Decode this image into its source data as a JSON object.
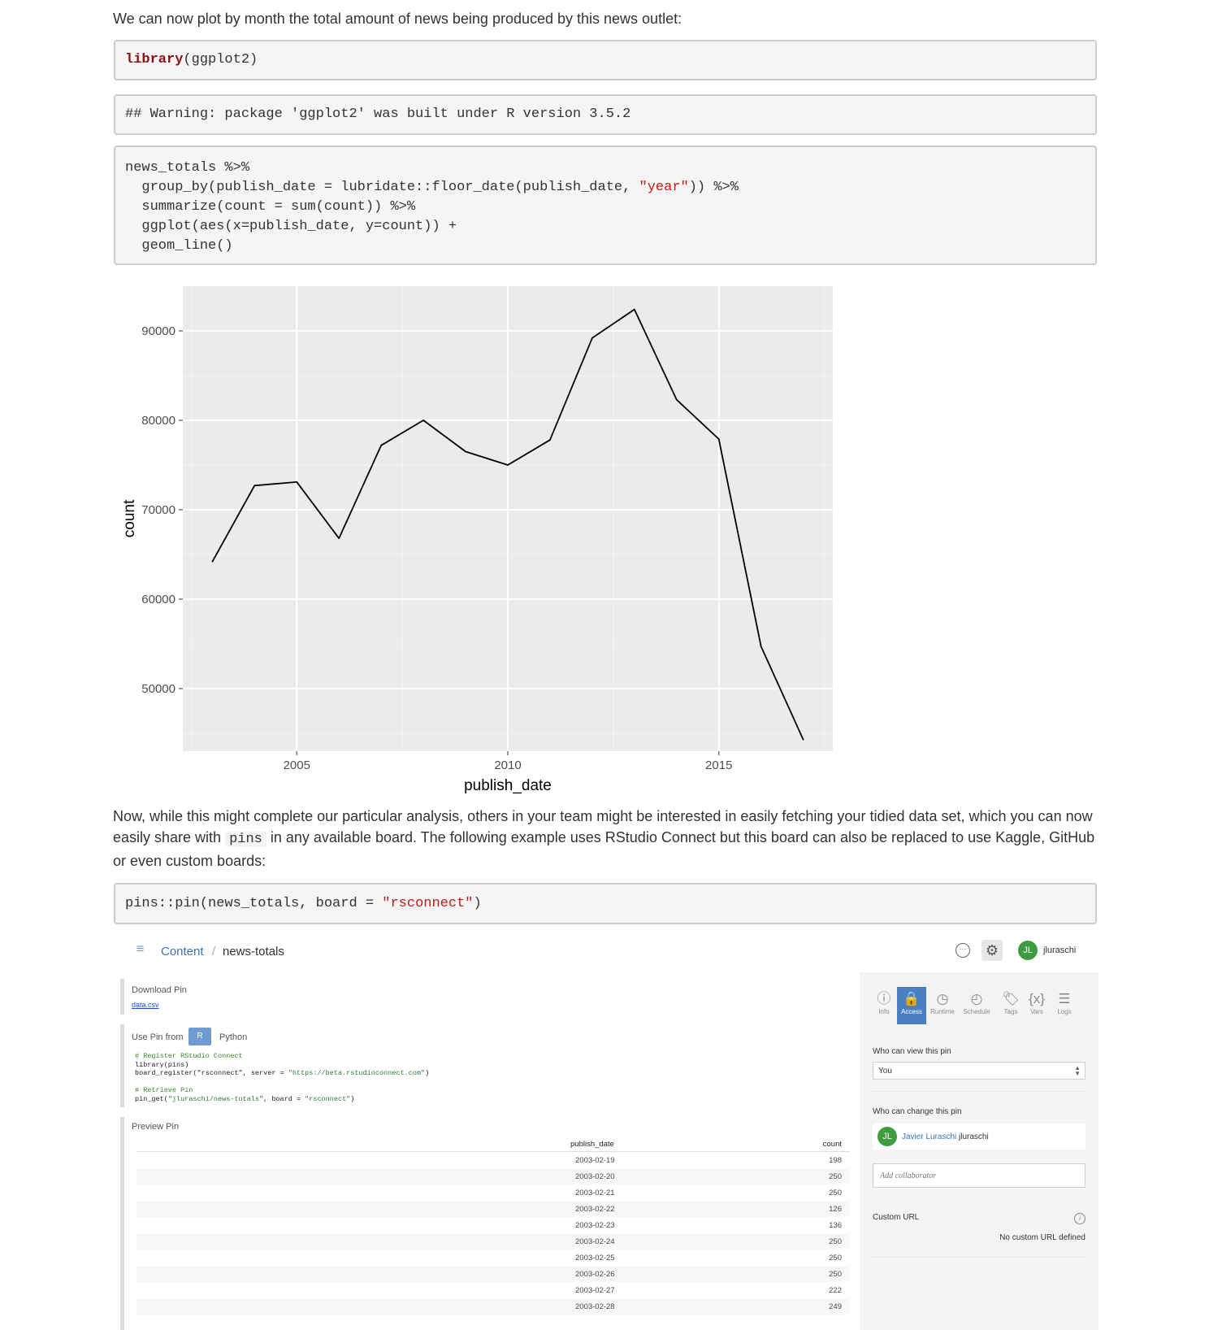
{
  "prose": {
    "p1": "We can now plot by month the total amount of news being produced by this news outlet:",
    "p2a": "Now, while this might complete our particular analysis, others in your team might be interested in easily fetching your tidied data set, which you can now easily share with ",
    "p2code": "pins",
    "p2b": " in any available board. The following example uses RStudio Connect but this board can also be replaced to use Kaggle, GitHub or even custom boards:"
  },
  "code": {
    "block1_kw": "library",
    "block1_rest": "(ggplot2)",
    "output1": "## Warning: package 'ggplot2' was built under R version 3.5.2",
    "block2_l1": "news_totals %>%",
    "block2_l2a": "  group_by(publish_date = lubridate::floor_date(publish_date, ",
    "block2_l2s": "\"year\"",
    "block2_l2b": ")) %>%",
    "block2_l3": "  summarize(count = sum(count)) %>%",
    "block2_l4": "  ggplot(aes(x=publish_date, y=count)) +",
    "block2_l5": "  geom_line()",
    "block3a": "pins::pin(news_totals, board = ",
    "block3s": "\"rsconnect\"",
    "block3b": ")"
  },
  "chart_data": {
    "type": "line",
    "xlabel": "publish_date",
    "ylabel": "count",
    "x": [
      2003,
      2004,
      2005,
      2006,
      2007,
      2008,
      2009,
      2010,
      2011,
      2012,
      2013,
      2014,
      2015,
      2016,
      2017
    ],
    "values": [
      64200,
      72700,
      73100,
      66800,
      77200,
      80000,
      76500,
      75000,
      77800,
      89200,
      92400,
      82300,
      77900,
      54700,
      44300
    ],
    "xticks": [
      2005,
      2010,
      2015
    ],
    "yticks": [
      50000,
      60000,
      70000,
      80000,
      90000
    ],
    "xlim": [
      2002.3,
      2017.7
    ],
    "ylim": [
      43000,
      95000
    ],
    "background": "#ebebeb",
    "grid": true
  },
  "rsc": {
    "breadcrumb_root": "Content",
    "breadcrumb_sep": "/",
    "breadcrumb_page": "news-totals",
    "user_initials": "JL",
    "username": "jluraschi",
    "download_title": "Download Pin",
    "download_link": "data.csv",
    "use_pin_label": "Use Pin from",
    "lang_r": "R",
    "lang_python": "Python",
    "code_c1": "# Register RStudio Connect",
    "code_l1": "library(pins)",
    "code_l2a": "board_register(\"rsconnect\", server = ",
    "code_l2s": "\"https://beta.rstudioconnect.com\"",
    "code_l2b": ")",
    "code_c2": "# Retrieve Pin",
    "code_l3a": "pin_get(",
    "code_l3s": "\"jluraschi/news-totals\"",
    "code_l3b": ", board = ",
    "code_l3s2": "\"rsconnect\"",
    "code_l3c": ")",
    "preview_title": "Preview Pin",
    "table_headers": [
      "publish_date",
      "count"
    ],
    "table_rows": [
      [
        "2003-02-19",
        "198"
      ],
      [
        "2003-02-20",
        "250"
      ],
      [
        "2003-02-21",
        "250"
      ],
      [
        "2003-02-22",
        "126"
      ],
      [
        "2003-02-23",
        "136"
      ],
      [
        "2003-02-24",
        "250"
      ],
      [
        "2003-02-25",
        "250"
      ],
      [
        "2003-02-26",
        "250"
      ],
      [
        "2003-02-27",
        "222"
      ],
      [
        "2003-02-28",
        "249"
      ]
    ],
    "tabs": [
      "Info",
      "Access",
      "Runtime",
      "Schedule",
      "Tags",
      "Vars",
      "Logs"
    ],
    "who_view_label": "Who can view this pin",
    "who_view_value": "You",
    "who_change_label": "Who can change this pin",
    "owner_name": "Javier Luraschi",
    "owner_user": "jluraschi",
    "add_collab_placeholder": "Add collaborator",
    "custom_url_label": "Custom URL",
    "custom_url_value": "No custom URL defined"
  },
  "colors": {
    "accent": "#4a7fc1",
    "avatar": "#3f9b3f",
    "link": "#3a75b5"
  }
}
